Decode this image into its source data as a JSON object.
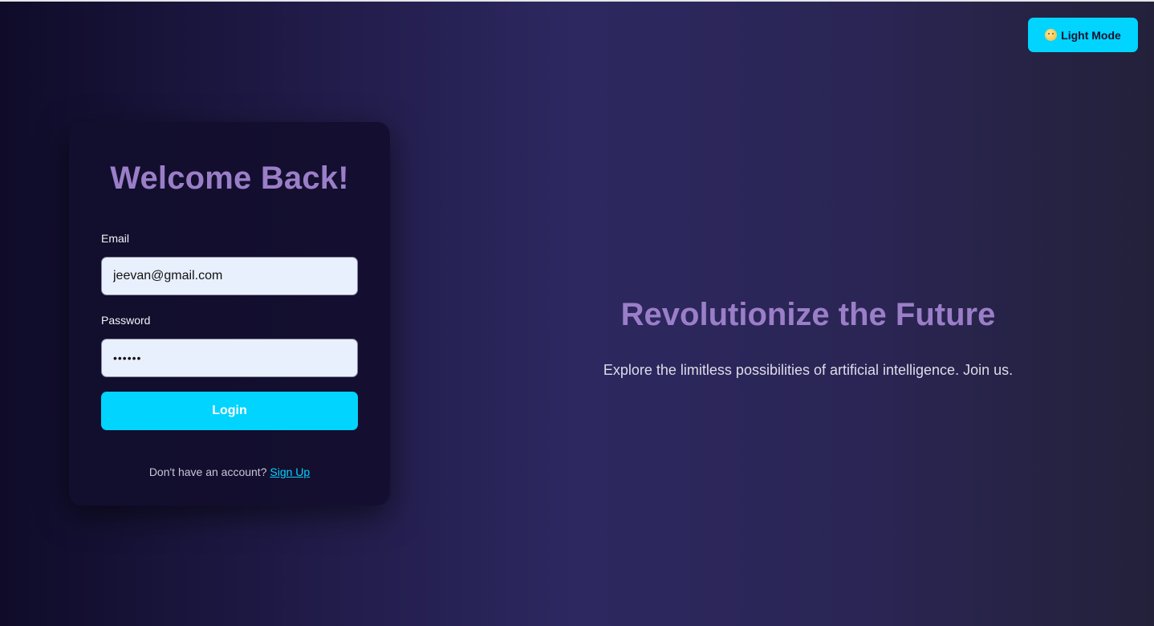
{
  "theme_toggle": {
    "icon": "moon-face-icon",
    "label": "Light Mode"
  },
  "login_card": {
    "title": "Welcome Back!",
    "email": {
      "label": "Email",
      "value": "jeevan@gmail.com"
    },
    "password": {
      "label": "Password",
      "value": "••••••"
    },
    "login_button_label": "Login",
    "signup_prompt": "Don't have an account?",
    "signup_link_label": "Sign Up"
  },
  "hero": {
    "title": "Revolutionize the Future",
    "subtitle": "Explore the limitless possibilities of artificial intelligence. Join us."
  },
  "colors": {
    "accent": "#00d4ff",
    "heading": "#9b7ec8",
    "card_background": "#120e2d",
    "input_background": "#e9f0fd"
  }
}
